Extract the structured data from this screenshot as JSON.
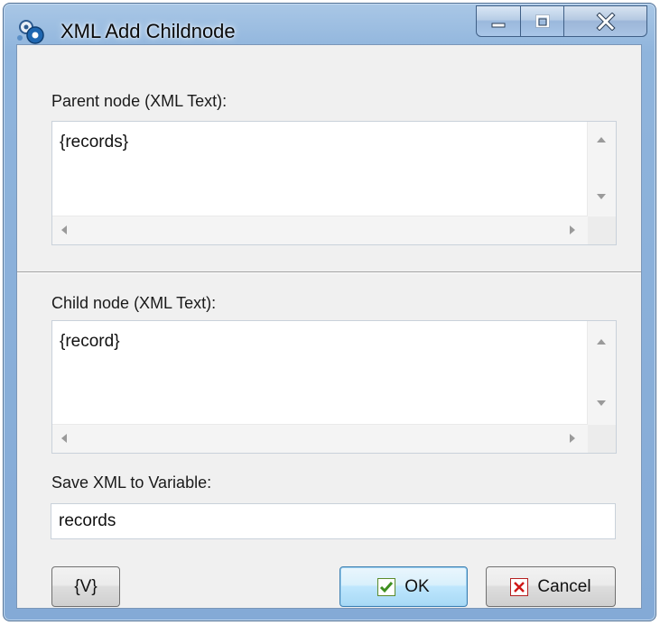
{
  "window": {
    "title": "XML Add Childnode"
  },
  "parent": {
    "label": "Parent node (XML Text):",
    "value": "{records}"
  },
  "child": {
    "label": "Child node (XML Text):",
    "value": "{record}"
  },
  "save": {
    "label": "Save XML to Variable:",
    "value": "records"
  },
  "buttons": {
    "variables": "{V}",
    "ok": "OK",
    "cancel": "Cancel"
  },
  "icons": {
    "app": "gears-icon",
    "ok": "checkmark-icon",
    "cancel": "x-mark-icon"
  },
  "colors": {
    "titlebar": "#8fb4dc",
    "ok_check": "#3f8f1f",
    "cancel_x": "#d01818"
  }
}
